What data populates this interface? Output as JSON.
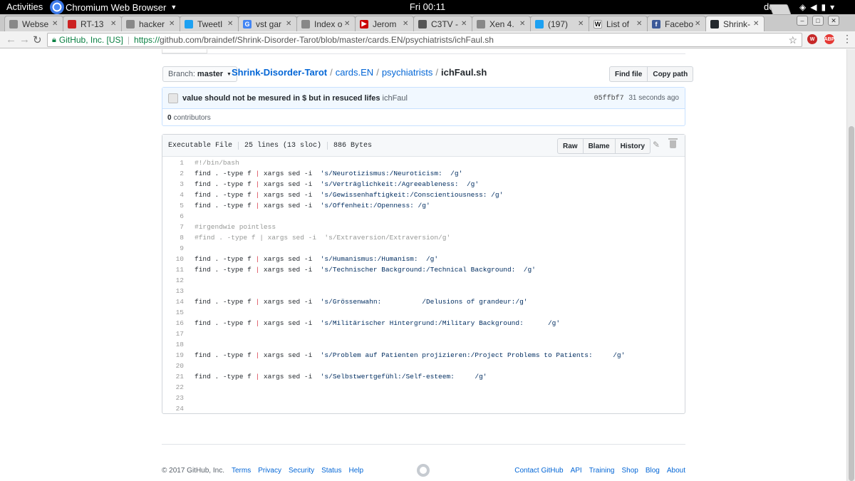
{
  "topbar": {
    "activities": "Activities",
    "app_name": "Chromium Web Browser",
    "clock": "Fri 00:11",
    "lang": "de"
  },
  "tabs": [
    {
      "label": "Webse",
      "fav_color": "#888888",
      "fav_text": ""
    },
    {
      "label": "RT-13",
      "fav_color": "#cc2222",
      "fav_text": ""
    },
    {
      "label": "hacker",
      "fav_color": "#888888",
      "fav_text": ""
    },
    {
      "label": "TweetI",
      "fav_color": "#1da1f2",
      "fav_text": ""
    },
    {
      "label": "vst gar",
      "fav_color": "#4285f4",
      "fav_text": "G"
    },
    {
      "label": "Index o",
      "fav_color": "#888888",
      "fav_text": ""
    },
    {
      "label": "Jerom",
      "fav_color": "#cc0000",
      "fav_text": "▶"
    },
    {
      "label": "C3TV -",
      "fav_color": "#555555",
      "fav_text": ""
    },
    {
      "label": "Xen 4.",
      "fav_color": "#888888",
      "fav_text": ""
    },
    {
      "label": "(197)",
      "fav_color": "#1da1f2",
      "fav_text": ""
    },
    {
      "label": "List of",
      "fav_color": "#ffffff",
      "fav_text": "W"
    },
    {
      "label": "Facebo",
      "fav_color": "#3b5998",
      "fav_text": "f"
    },
    {
      "label": "Shrink-",
      "fav_color": "#24292e",
      "fav_text": ""
    }
  ],
  "address": {
    "org": "GitHub, Inc. [US]",
    "scheme": "https://",
    "url": "github.com/braindef/Shrink-Disorder-Tarot/blob/master/cards.EN/psychiatrists/ichFaul.sh"
  },
  "extensions": [
    {
      "color": "#c62828",
      "text": "W"
    },
    {
      "color": "#e53935",
      "text": "ABP"
    }
  ],
  "repo": {
    "branch_label": "Branch:",
    "branch": "master",
    "repo_name": "Shrink-Disorder-Tarot",
    "dir1": "cards.EN",
    "dir2": "psychiatrists",
    "file": "ichFaul.sh",
    "find_file": "Find file",
    "copy_path": "Copy path"
  },
  "commit": {
    "message": "value should not be mesured in $ but in resuced lifes",
    "author": "ichFaul",
    "sha": "05ffbf7",
    "time": "31 seconds ago",
    "contributors_count": "0",
    "contributors_label": "contributors"
  },
  "file": {
    "mode": "Executable File",
    "lines": "25 lines (13 sloc)",
    "size": "886 Bytes",
    "raw": "Raw",
    "blame": "Blame",
    "history": "History"
  },
  "code_lines": [
    {
      "n": "1",
      "type": "comment",
      "text": "#!/bin/bash"
    },
    {
      "n": "2",
      "type": "cmd",
      "str": "'s/Neurotizismus:/Neuroticism:  /g'"
    },
    {
      "n": "3",
      "type": "cmd",
      "str": "'s/Verträglichkeit:/Agreeableness:  /g'"
    },
    {
      "n": "4",
      "type": "cmd",
      "str": "'s/Gewissenhaftigkeit:/Conscientiousness: /g'"
    },
    {
      "n": "5",
      "type": "cmd",
      "str": "'s/Offenheit:/Openness: /g'"
    },
    {
      "n": "6",
      "type": "empty",
      "text": ""
    },
    {
      "n": "7",
      "type": "comment",
      "text": "#irgendwie pointless"
    },
    {
      "n": "8",
      "type": "comment",
      "text": "#find . -type f | xargs sed -i  's/Extraversion/Extraversion/g'"
    },
    {
      "n": "9",
      "type": "empty",
      "text": ""
    },
    {
      "n": "10",
      "type": "cmd",
      "str": "'s/Humanismus:/Humanism:  /g'"
    },
    {
      "n": "11",
      "type": "cmd",
      "str": "'s/Technischer Background:/Technical Background:  /g'"
    },
    {
      "n": "12",
      "type": "empty",
      "text": ""
    },
    {
      "n": "13",
      "type": "empty",
      "text": ""
    },
    {
      "n": "14",
      "type": "cmd",
      "str": "'s/Grössenwahn:          /Delusions of grandeur:/g'"
    },
    {
      "n": "15",
      "type": "empty",
      "text": ""
    },
    {
      "n": "16",
      "type": "cmd",
      "str": "'s/Militärischer Hintergrund:/Military Background:      /g'"
    },
    {
      "n": "17",
      "type": "empty",
      "text": ""
    },
    {
      "n": "18",
      "type": "empty",
      "text": ""
    },
    {
      "n": "19",
      "type": "cmd",
      "str": "'s/Problem auf Patienten projizieren:/Project Problems to Patients:     /g'"
    },
    {
      "n": "20",
      "type": "empty",
      "text": ""
    },
    {
      "n": "21",
      "type": "cmd",
      "str": "'s/Selbstwertgefühl:/Self-esteem:     /g'"
    },
    {
      "n": "22",
      "type": "empty",
      "text": ""
    },
    {
      "n": "23",
      "type": "empty",
      "text": ""
    },
    {
      "n": "24",
      "type": "empty",
      "text": ""
    }
  ],
  "cmd_prefix": "find . -type f ",
  "cmd_pipe": "|",
  "cmd_middle": " xargs sed -i  ",
  "footer": {
    "copyright": "© 2017 GitHub, Inc.",
    "left_links": [
      "Terms",
      "Privacy",
      "Security",
      "Status",
      "Help"
    ],
    "right_links": [
      "Contact GitHub",
      "API",
      "Training",
      "Shop",
      "Blog",
      "About"
    ]
  }
}
